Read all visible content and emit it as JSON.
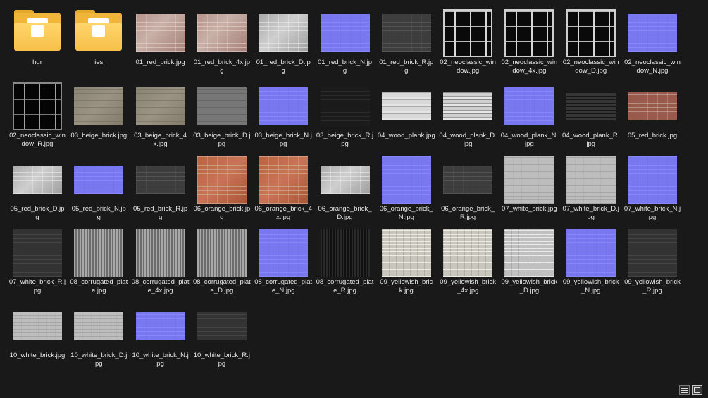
{
  "view_toggles": {
    "details": "details-view",
    "large_icons": "large-icons-view"
  },
  "folders": [
    {
      "name": "hdr"
    },
    {
      "name": "ies"
    }
  ],
  "files": [
    {
      "name": "01_red_brick.jpg",
      "kind": "redbrick"
    },
    {
      "name": "01_red_brick_4x.jpg",
      "kind": "redbrick"
    },
    {
      "name": "01_red_brick_D.jpg",
      "kind": "greybrick"
    },
    {
      "name": "01_red_brick_N.jpg",
      "kind": "normal"
    },
    {
      "name": "01_red_brick_R.jpg",
      "kind": "darkbrick"
    },
    {
      "name": "02_neoclassic_window.jpg",
      "kind": "window"
    },
    {
      "name": "02_neoclassic_window_4x.jpg",
      "kind": "window"
    },
    {
      "name": "02_neoclassic_window_D.jpg",
      "kind": "window"
    },
    {
      "name": "02_neoclassic_window_N.jpg",
      "kind": "normal"
    },
    {
      "name": "02_neoclassic_window_R.jpg",
      "kind": "window-r"
    },
    {
      "name": "03_beige_brick.jpg",
      "kind": "beige"
    },
    {
      "name": "03_beige_brick_4x.jpg",
      "kind": "beige"
    },
    {
      "name": "03_beige_brick_D.jpg",
      "kind": "beige-d"
    },
    {
      "name": "03_beige_brick_N.jpg",
      "kind": "normal"
    },
    {
      "name": "03_beige_brick_R.jpg",
      "kind": "black-r"
    },
    {
      "name": "04_wood_plank.jpg",
      "kind": "wood"
    },
    {
      "name": "04_wood_plank_D.jpg",
      "kind": "wood-d"
    },
    {
      "name": "04_wood_plank_N.jpg",
      "kind": "normal"
    },
    {
      "name": "04_wood_plank_R.jpg",
      "kind": "wood-r"
    },
    {
      "name": "05_red_brick.jpg",
      "kind": "red05"
    },
    {
      "name": "05_red_brick_D.jpg",
      "kind": "greybrick"
    },
    {
      "name": "05_red_brick_N.jpg",
      "kind": "normal"
    },
    {
      "name": "05_red_brick_R.jpg",
      "kind": "darkbrick"
    },
    {
      "name": "06_orange_brick.jpg",
      "kind": "orange"
    },
    {
      "name": "06_orange_brick_4x.jpg",
      "kind": "orange"
    },
    {
      "name": "06_orange_brick_D.jpg",
      "kind": "greybrick"
    },
    {
      "name": "06_orange_brick_N.jpg",
      "kind": "normal"
    },
    {
      "name": "06_orange_brick_R.jpg",
      "kind": "darkbrick"
    },
    {
      "name": "07_white_brick.jpg",
      "kind": "white"
    },
    {
      "name": "07_white_brick_D.jpg",
      "kind": "white"
    },
    {
      "name": "07_white_brick_N.jpg",
      "kind": "normal"
    },
    {
      "name": "07_white_brick_R.jpg",
      "kind": "darkgrey"
    },
    {
      "name": "08_corrugated_plate.jpg",
      "kind": "corrug"
    },
    {
      "name": "08_corrugated_plate_4x.jpg",
      "kind": "corrug"
    },
    {
      "name": "08_corrugated_plate_D.jpg",
      "kind": "corrug"
    },
    {
      "name": "08_corrugated_plate_N.jpg",
      "kind": "normal"
    },
    {
      "name": "08_corrugated_plate_R.jpg",
      "kind": "corrug-r"
    },
    {
      "name": "09_yellowish_brick.jpg",
      "kind": "yellow"
    },
    {
      "name": "09_yellowish_brick_4x.jpg",
      "kind": "yellow"
    },
    {
      "name": "09_yellowish_brick_D.jpg",
      "kind": "yellow-d"
    },
    {
      "name": "09_yellowish_brick_N.jpg",
      "kind": "normal"
    },
    {
      "name": "09_yellowish_brick_R.jpg",
      "kind": "darkgrey"
    },
    {
      "name": "10_white_brick.jpg",
      "kind": "white"
    },
    {
      "name": "10_white_brick_D.jpg",
      "kind": "white"
    },
    {
      "name": "10_white_brick_N.jpg",
      "kind": "normal"
    },
    {
      "name": "10_white_brick_R.jpg",
      "kind": "darkgrey"
    }
  ]
}
